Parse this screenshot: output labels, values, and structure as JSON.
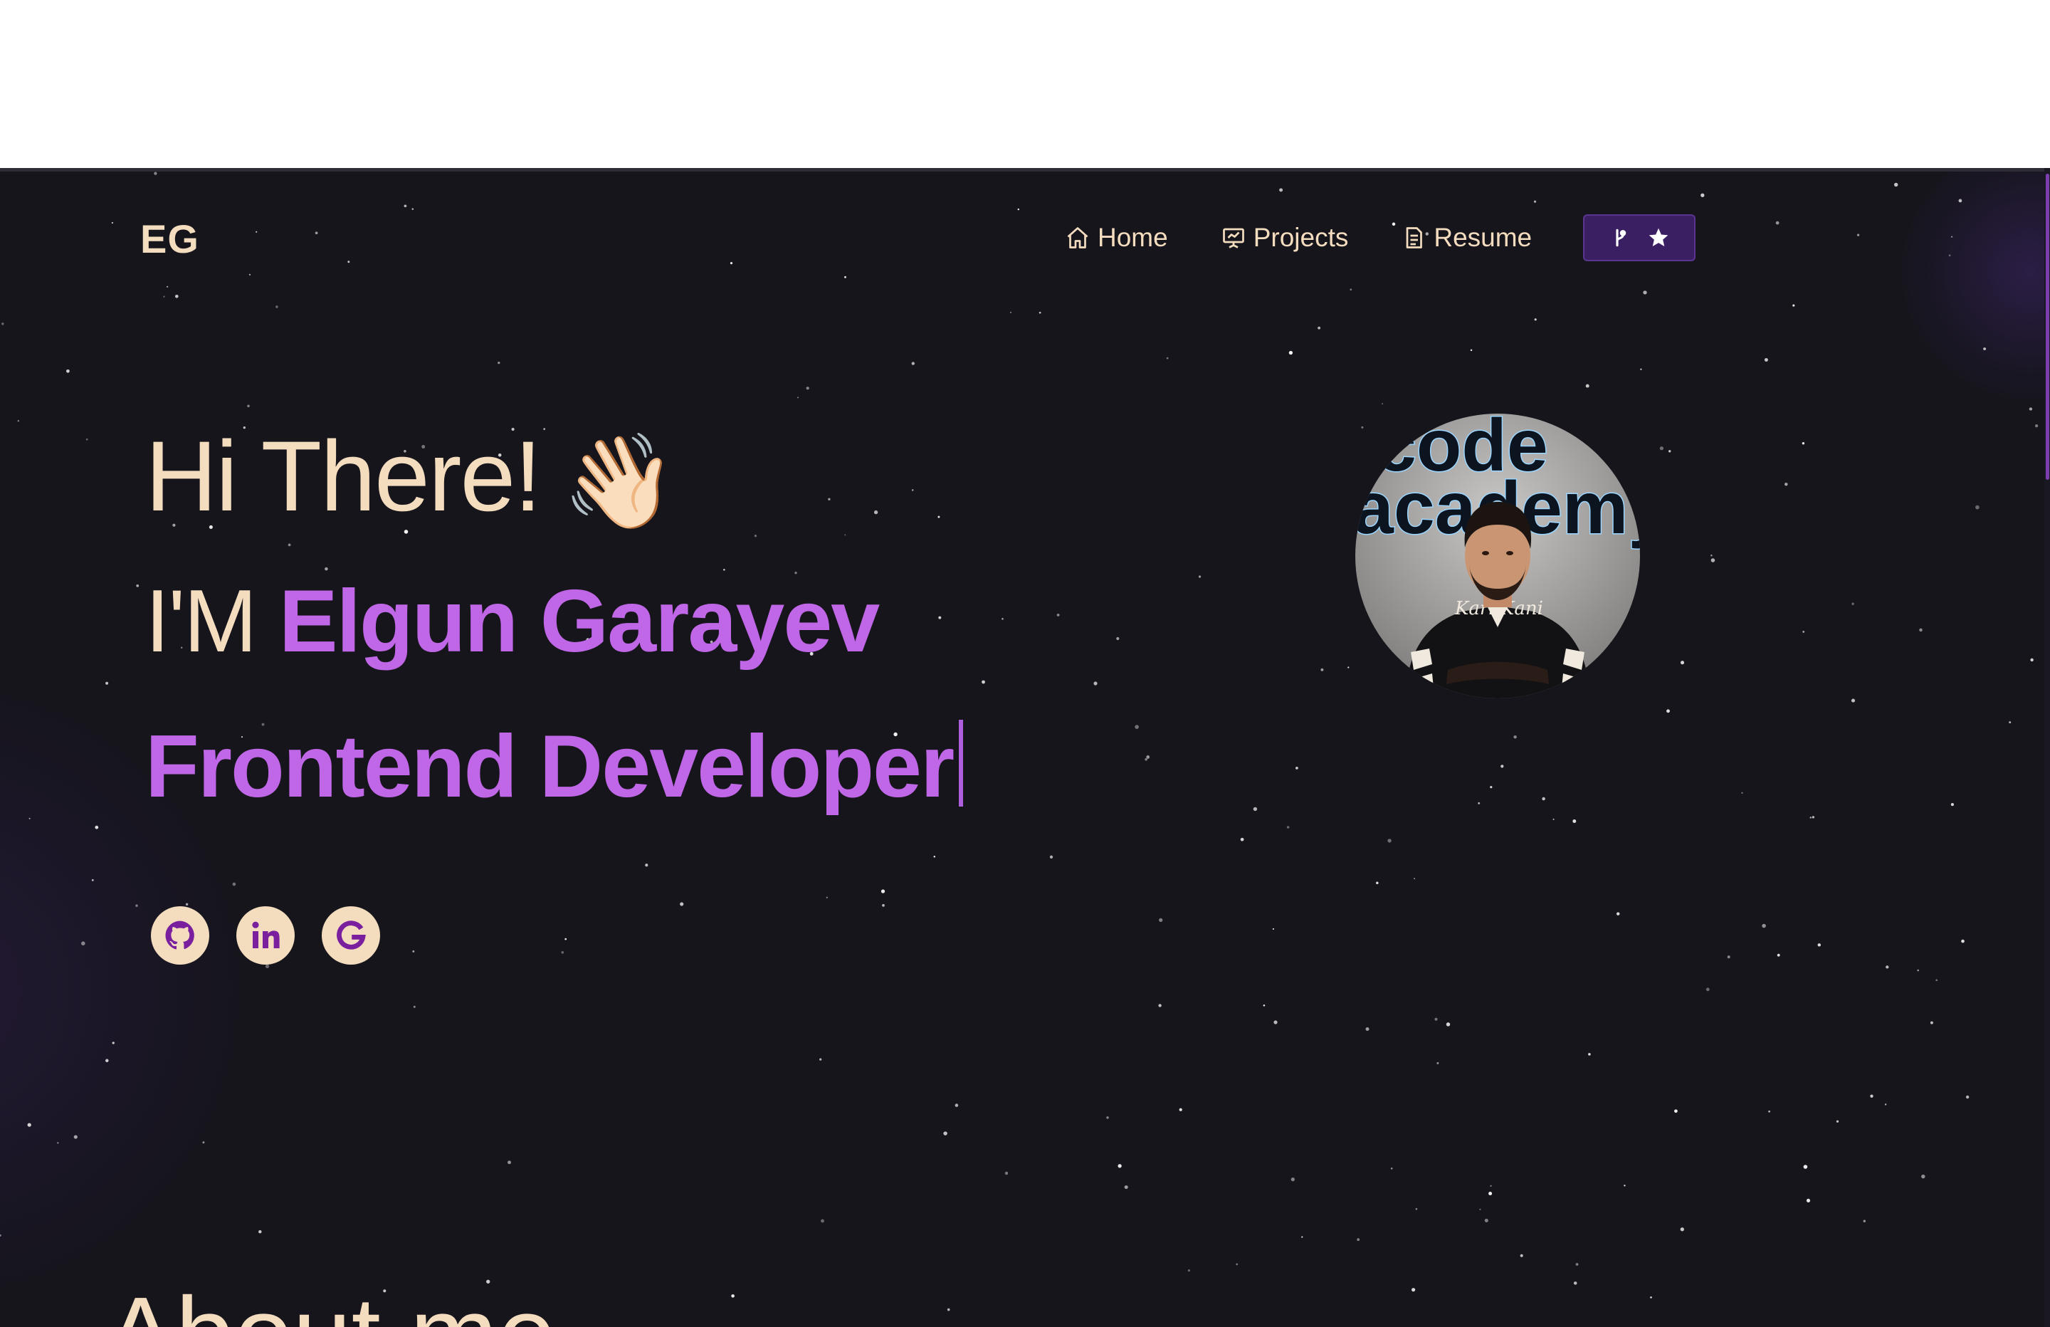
{
  "logo": "EG",
  "nav": {
    "items": [
      {
        "label": "Home",
        "icon": "home-icon"
      },
      {
        "label": "Projects",
        "icon": "presentation-icon"
      },
      {
        "label": "Resume",
        "icon": "document-icon"
      }
    ],
    "github_button": {
      "icons": [
        "git-fork-icon",
        "star-icon"
      ]
    }
  },
  "hero": {
    "greeting": "Hi There!",
    "wave_emoji": "👋🏻",
    "name_prefix": "I'M",
    "name": "Elgun Garayev",
    "role": "Frontend Developer"
  },
  "socials": [
    {
      "name": "github",
      "icon": "github-icon"
    },
    {
      "name": "linkedin",
      "icon": "linkedin-icon"
    },
    {
      "name": "google",
      "icon": "google-icon"
    }
  ],
  "avatar": {
    "sign_line_1": "code",
    "sign_line_2": "academy",
    "jacket_text": "Karl Kani"
  },
  "about": {
    "title": "About me"
  },
  "colors": {
    "background": "#16151c",
    "cream": "#f4dcbf",
    "purple": "#c067e8",
    "button": "#3b1f63"
  }
}
